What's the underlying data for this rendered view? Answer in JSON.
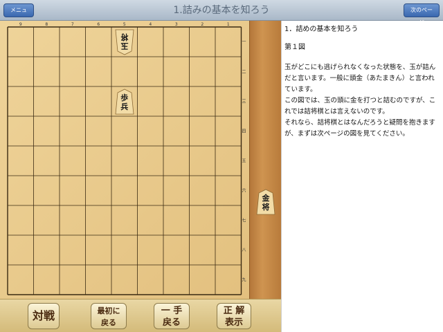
{
  "navbar": {
    "menu_label": "メニュー",
    "title": "1.詰みの基本を知ろう",
    "next_label": "次のページ",
    "accent_color": "#3a68b0"
  },
  "board": {
    "files": [
      "9",
      "8",
      "7",
      "6",
      "5",
      "4",
      "3",
      "2",
      "1"
    ],
    "ranks": [
      "一",
      "二",
      "三",
      "四",
      "五",
      "六",
      "七",
      "八",
      "九"
    ],
    "pieces": [
      {
        "name": "gyoku",
        "chars": [
          "玉",
          "将"
        ],
        "file": 5,
        "rank": 1,
        "owner": "gote"
      },
      {
        "name": "fu",
        "chars": [
          "歩",
          "兵"
        ],
        "file": 5,
        "rank": 3,
        "owner": "sente"
      }
    ]
  },
  "hand": {
    "pieces": [
      {
        "name": "kin",
        "chars": [
          "金",
          "将"
        ],
        "owner": "sente"
      }
    ]
  },
  "toolbar": {
    "taisen": "対戦",
    "saisho_line1": "最初に",
    "saisho_line2": "戻る",
    "itte_line1": "一 手",
    "itte_line2": "戻る",
    "seikai_line1": "正 解",
    "seikai_line2": "表示"
  },
  "panel": {
    "heading": "1．詰めの基本を知ろう",
    "figure": "第１図",
    "paragraphs": [
      "玉がどこにも逃げられなくなった状態を、玉が詰んだと言います。一般に頭金（あたまきん）と言われています。",
      "この図では、玉の頭に金を打つと詰むのですが、これでは詰将棋とは言えないのです。",
      "それなら、詰将棋とはなんだろうと疑問を抱きますが、まずは次ページの図を見てください。"
    ]
  }
}
